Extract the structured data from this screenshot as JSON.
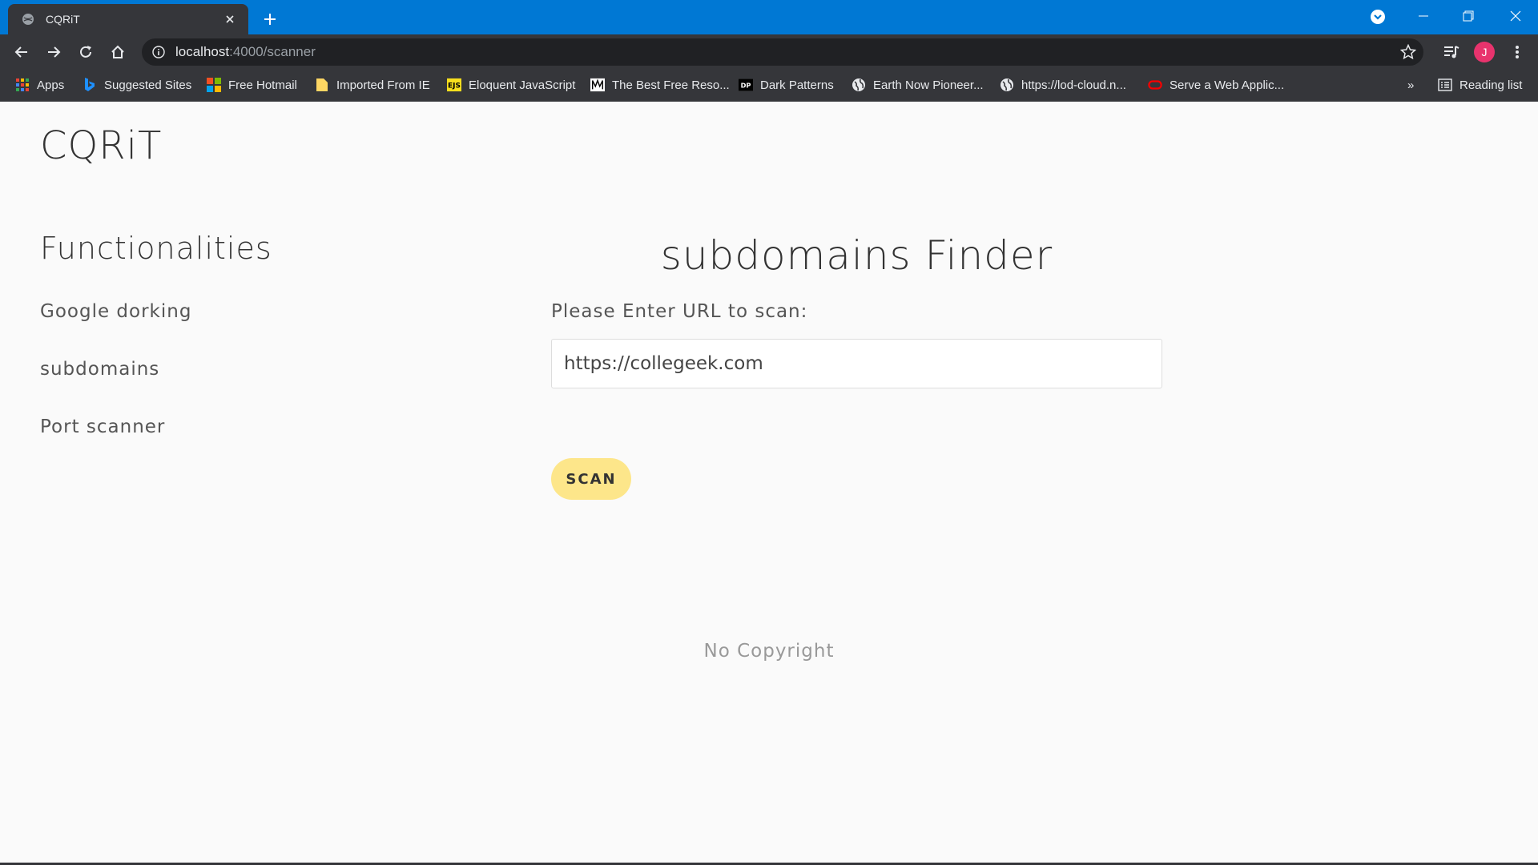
{
  "browser": {
    "tab_title": "CQRiT",
    "url_host": "localhost",
    "url_path": ":4000/scanner",
    "bookmarks": [
      {
        "label": "Apps",
        "icon": "apps-grid-icon"
      },
      {
        "label": "Suggested Sites",
        "icon": "bing-icon"
      },
      {
        "label": "Free Hotmail",
        "icon": "windows-icon"
      },
      {
        "label": "Imported From IE",
        "icon": "folder-icon"
      },
      {
        "label": "Eloquent JavaScript",
        "icon": "ejs-icon"
      },
      {
        "label": "The Best Free Reso...",
        "icon": "website-icon"
      },
      {
        "label": "Dark Patterns",
        "icon": "dp-icon"
      },
      {
        "label": "Earth Now Pioneer...",
        "icon": "globe-icon"
      },
      {
        "label": "https://lod-cloud.n...",
        "icon": "globe-icon"
      },
      {
        "label": "Serve a Web Applic...",
        "icon": "oracle-icon"
      }
    ],
    "reading_list": "Reading list",
    "avatar_letter": "J",
    "overflow": "»"
  },
  "page": {
    "brand": "CQRiT",
    "sidebar": {
      "title": "Functionalities",
      "links": [
        "Google dorking",
        "subdomains",
        "Port scanner"
      ]
    },
    "main": {
      "title": "subdomains Finder",
      "url_label": "Please Enter URL to scan:",
      "url_value": "https://collegeek.com",
      "scan_label": "SCAN"
    },
    "footer": "No Copyright"
  },
  "colors": {
    "titlebar": "#0078d4",
    "chrome": "#35363a",
    "page_bg": "#fafafa",
    "scan_button": "#fde68a",
    "avatar": "#e8336d"
  }
}
